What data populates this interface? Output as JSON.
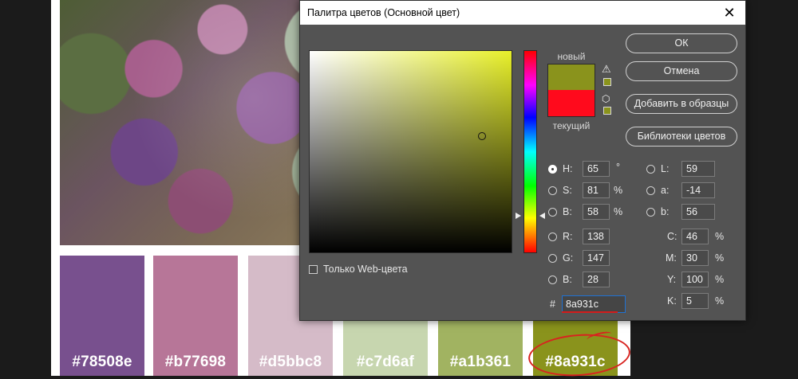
{
  "background": {
    "swatches": [
      {
        "label": "#78508e",
        "color": "#78508e"
      },
      {
        "label": "#b77698",
        "color": "#b77698"
      },
      {
        "label": "#d5bbc8",
        "color": "#d5bbc8"
      },
      {
        "label": "#c7d6af",
        "color": "#c7d6af"
      },
      {
        "label": "#a1b361",
        "color": "#a1b361"
      },
      {
        "label": "#8a931c",
        "color": "#8a931c"
      }
    ]
  },
  "dialog": {
    "title": "Палитра цветов (Основной цвет)",
    "close_icon": "close-icon",
    "new_label": "новый",
    "current_label": "текущий",
    "new_color": "#8a931c",
    "current_color": "#ff0a1c",
    "gamut_warning_icon": "warning-icon",
    "websafe_icon": "cube-icon",
    "gamut_swatch_color": "#8a931c",
    "websafe_swatch_color": "#8a931c",
    "buttons": {
      "ok": "ОК",
      "cancel": "Отмена",
      "add_swatch": "Добавить в образцы",
      "libraries": "Библиотеки цветов"
    },
    "web_only_label": "Только Web-цвета",
    "hsb": {
      "h_label": "H:",
      "h_value": "65",
      "h_unit": "°",
      "s_label": "S:",
      "s_value": "81",
      "s_unit": "%",
      "b_label": "B:",
      "b_value": "58",
      "b_unit": "%"
    },
    "rgb": {
      "r_label": "R:",
      "r_value": "138",
      "g_label": "G:",
      "g_value": "147",
      "b_label": "B:",
      "b_value": "28"
    },
    "lab": {
      "l_label": "L:",
      "l_value": "59",
      "a_label": "a:",
      "a_value": "-14",
      "b_label": "b:",
      "b_value": "56"
    },
    "cmyk": {
      "c_label": "C:",
      "c_value": "46",
      "c_unit": "%",
      "m_label": "M:",
      "m_value": "30",
      "m_unit": "%",
      "y_label": "Y:",
      "y_value": "100",
      "y_unit": "%",
      "k_label": "K:",
      "k_value": "5",
      "k_unit": "%"
    },
    "hex_label": "#",
    "hex_value": "8a931c"
  }
}
